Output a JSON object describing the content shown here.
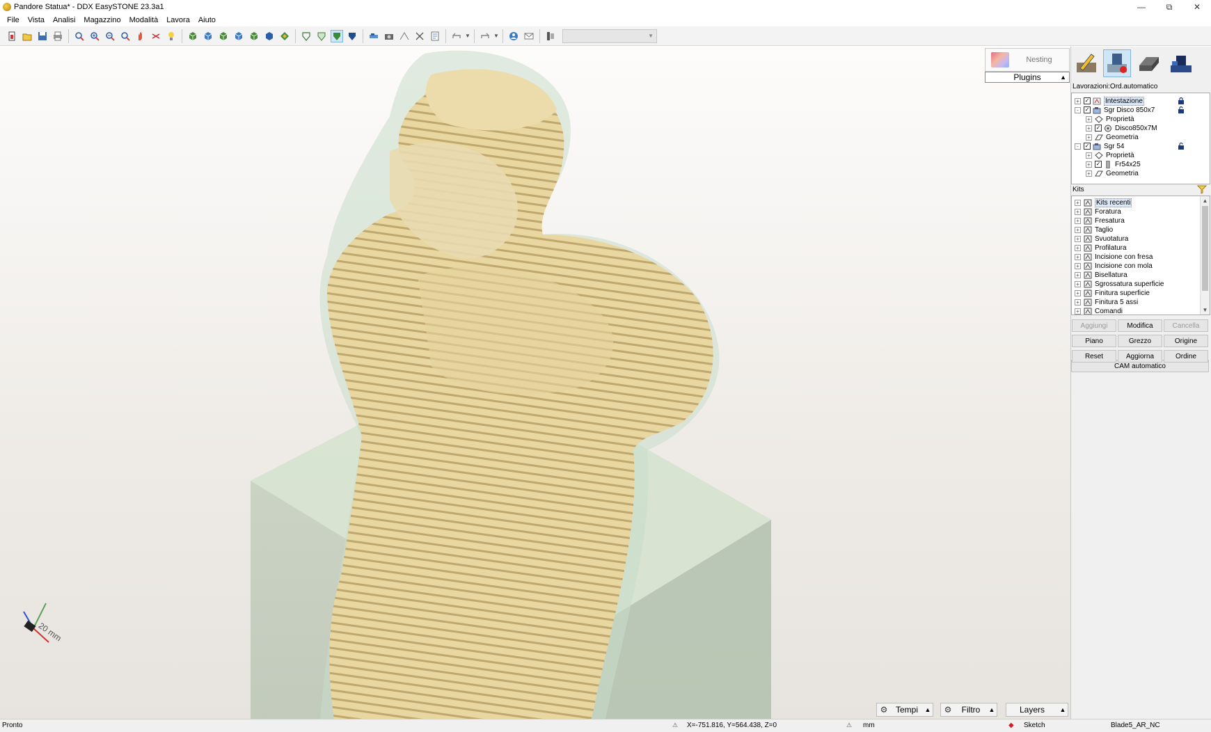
{
  "window": {
    "title": "Pandore Statua* - DDX EasySTONE 23.3a1",
    "controls": {
      "minimize": "—",
      "maximize": "⧉",
      "close": "✕"
    }
  },
  "menu": [
    "File",
    "Vista",
    "Analisi",
    "Magazzino",
    "Modalità",
    "Lavora",
    "Aiuto"
  ],
  "toolbar": {
    "icons": [
      "new-icon",
      "open-icon",
      "save-icon",
      "print-icon",
      "zoom-window-icon",
      "zoom-extents-icon",
      "zoom-out-icon",
      "zoom-in-icon",
      "pan-hand-icon",
      "rotate-icon",
      "light-icon",
      "view-front-icon",
      "view-back-icon",
      "view-left-icon",
      "view-right-icon",
      "view-top-icon",
      "view-iso-icon",
      "view-3d-icon",
      "shade-wire-icon",
      "shade-half-icon",
      "shade-solid-icon",
      "shade-dark-icon",
      "measure-icon",
      "camera-icon",
      "tool-path-icon",
      "select-icon",
      "report-icon",
      "undo-icon",
      "redo-icon",
      "user-icon",
      "mail-icon",
      "device-icon"
    ],
    "combo_value": ""
  },
  "viewport": {
    "axis_label": "20 mm",
    "tabs": [
      {
        "label": "Tempi",
        "icon": "gear-icon"
      },
      {
        "label": "Filtro",
        "icon": "gear-icon"
      },
      {
        "label": "Layers",
        "icon": ""
      }
    ]
  },
  "panel": {
    "nesting_label": "Nesting",
    "plugins_label": "Plugins",
    "mode_buttons": [
      "drawing-mode-icon",
      "cam-mode-icon",
      "slab-mode-icon",
      "machine-mode-icon"
    ],
    "lavorazioni_label": "Lavorazioni:Ord.automatico",
    "lavorazioni_tree": [
      {
        "label": "Intestazione",
        "level": 0,
        "expander": "+",
        "checked": true,
        "icon": "header-icon",
        "lock": "locked",
        "selected": true
      },
      {
        "label": "Sgr Disco 850x7",
        "level": 0,
        "expander": "-",
        "checked": true,
        "icon": "operation-icon",
        "lock": "unlocked",
        "selected": false
      },
      {
        "label": "Proprietà",
        "level": 1,
        "expander": "+",
        "checked": null,
        "icon": "properties-icon",
        "lock": "",
        "selected": false
      },
      {
        "label": "Disco850x7M",
        "level": 1,
        "expander": "+",
        "checked": true,
        "icon": "disk-tool-icon",
        "lock": "",
        "selected": false
      },
      {
        "label": "Geometria",
        "level": 1,
        "expander": "+",
        "checked": null,
        "icon": "geometry-icon",
        "lock": "",
        "selected": false
      },
      {
        "label": "Sgr 54",
        "level": 0,
        "expander": "-",
        "checked": true,
        "icon": "operation-icon",
        "lock": "unlocked",
        "selected": false
      },
      {
        "label": "Proprietà",
        "level": 1,
        "expander": "+",
        "checked": null,
        "icon": "properties-icon",
        "lock": "",
        "selected": false
      },
      {
        "label": "Fr54x25",
        "level": 1,
        "expander": "+",
        "checked": true,
        "icon": "mill-tool-icon",
        "lock": "",
        "selected": false
      },
      {
        "label": "Geometria",
        "level": 1,
        "expander": "+",
        "checked": null,
        "icon": "geometry-icon",
        "lock": "",
        "selected": false
      }
    ],
    "kits_label": "Kits",
    "kits": [
      "Kits recenti",
      "Foratura",
      "Fresatura",
      "Taglio",
      "Svuotatura",
      "Profilatura",
      "Incisione con fresa",
      "Incisione con mola",
      "Bisellatura",
      "Sgrossatura superficie",
      "Finitura superficie",
      "Finitura 5 assi",
      "Comandi"
    ],
    "buttons": [
      {
        "label": "Aggiungi",
        "enabled": false
      },
      {
        "label": "Modifica",
        "enabled": true
      },
      {
        "label": "Cancella",
        "enabled": false
      },
      {
        "label": "Piano",
        "enabled": true
      },
      {
        "label": "Grezzo",
        "enabled": true
      },
      {
        "label": "Origine",
        "enabled": true
      },
      {
        "label": "Reset",
        "enabled": true
      },
      {
        "label": "Aggiorna",
        "enabled": true
      },
      {
        "label": "Ordine",
        "enabled": true
      }
    ],
    "cam_button": "CAM automatico"
  },
  "status": {
    "state": "Pronto",
    "coordinates": "X=-751.816, Y=564.438, Z=0",
    "units": "mm",
    "mode": "Sketch",
    "machine": "Blade5_AR_NC"
  },
  "colors": {
    "statue": "#e8d7a0",
    "statue_shadow": "#b89f64",
    "ghost": "#c9dccb",
    "block": "#d6e0cf",
    "selection": "#cfe6f7"
  }
}
